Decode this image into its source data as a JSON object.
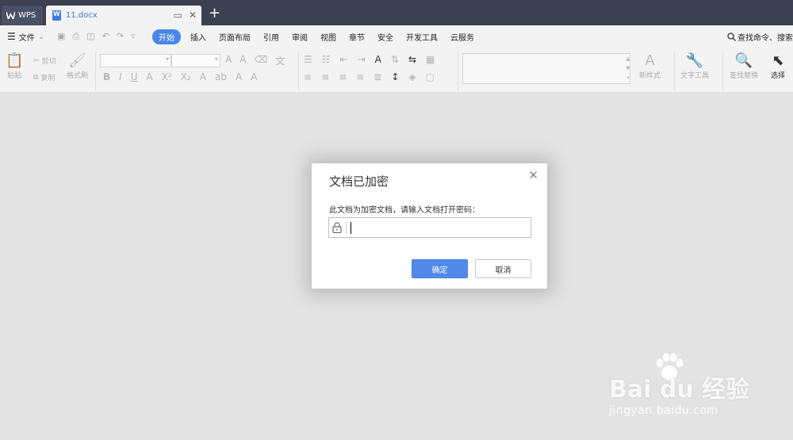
{
  "titlebar": {
    "wps_tab": "WPS",
    "doc_tab": "11.docx",
    "new_tab": "+"
  },
  "menubar": {
    "file_label": "文件",
    "items": [
      "开始",
      "插入",
      "页面布局",
      "引用",
      "审阅",
      "视图",
      "章节",
      "安全",
      "开发工具",
      "云服务"
    ],
    "active_index": 0,
    "search_label": "查找命令、搜索"
  },
  "ribbon": {
    "paste": "粘贴",
    "cut": "剪切",
    "copy": "复制",
    "format_painter": "格式刷",
    "new_style": "新样式",
    "text_tools": "文字工具",
    "find_replace": "查找替换",
    "select": "选择"
  },
  "dialog": {
    "title": "文档已加密",
    "prompt": "此文档为加密文档，请输入文档打开密码：",
    "password_value": "",
    "ok_label": "确定",
    "cancel_label": "取消"
  },
  "watermark": {
    "brand": "Bai du 经验",
    "url": "jingyan.baidu.com"
  },
  "colors": {
    "accent": "#4a86e8",
    "titlebar": "#3c4051",
    "background": "#e3e3e3"
  }
}
